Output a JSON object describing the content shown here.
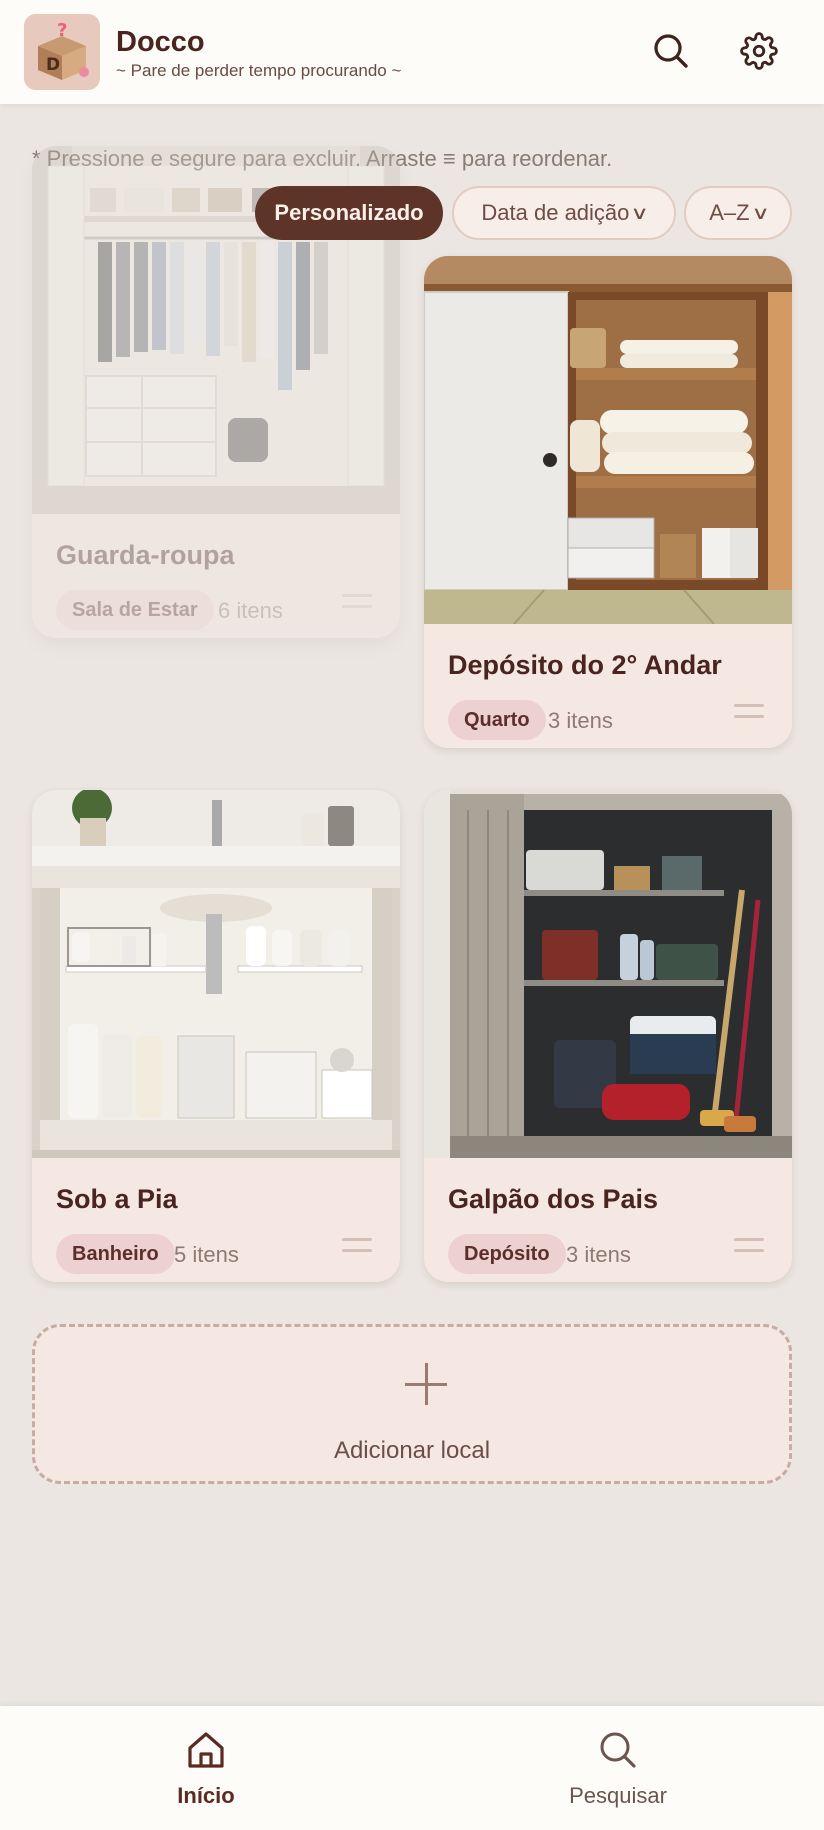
{
  "header": {
    "title": "Docco",
    "subtitle": "~ Pare de perder tempo procurando ~",
    "logo_letter": "D",
    "logo_mark": "?",
    "search_icon": "search-icon",
    "settings_icon": "gear-icon"
  },
  "hint": "* Pressione e segure para excluir. Arraste ≡ para reordenar.",
  "sort": {
    "options": [
      {
        "label": "Personalizado",
        "active": true
      },
      {
        "label": "Data de adição",
        "active": false,
        "arrow": "∨"
      },
      {
        "label": "A–Z",
        "active": false,
        "arrow": "∨"
      }
    ]
  },
  "locations": [
    {
      "name": "Guarda-roupa",
      "tag": "Sala de Estar",
      "count": "6 itens",
      "state": "dragging"
    },
    {
      "name": "Depósito do 2°  Andar",
      "tag": "Quarto",
      "count": "3 itens"
    },
    {
      "name": "Sob a Pia",
      "tag": "Banheiro",
      "count": "5 itens"
    },
    {
      "name": "Galpão dos Pais",
      "tag": "Depósito",
      "count": "3 itens"
    }
  ],
  "add_location": {
    "label": "Adicionar local"
  },
  "bottom_nav": {
    "items": [
      {
        "label": "Início",
        "icon": "home-icon",
        "active": true
      },
      {
        "label": "Pesquisar",
        "icon": "search-icon",
        "active": false
      }
    ]
  },
  "colors": {
    "background": "#ebe6e1",
    "accent": "#5e3429",
    "card": "#f5e8e2",
    "tag": "#ecd1d0"
  }
}
